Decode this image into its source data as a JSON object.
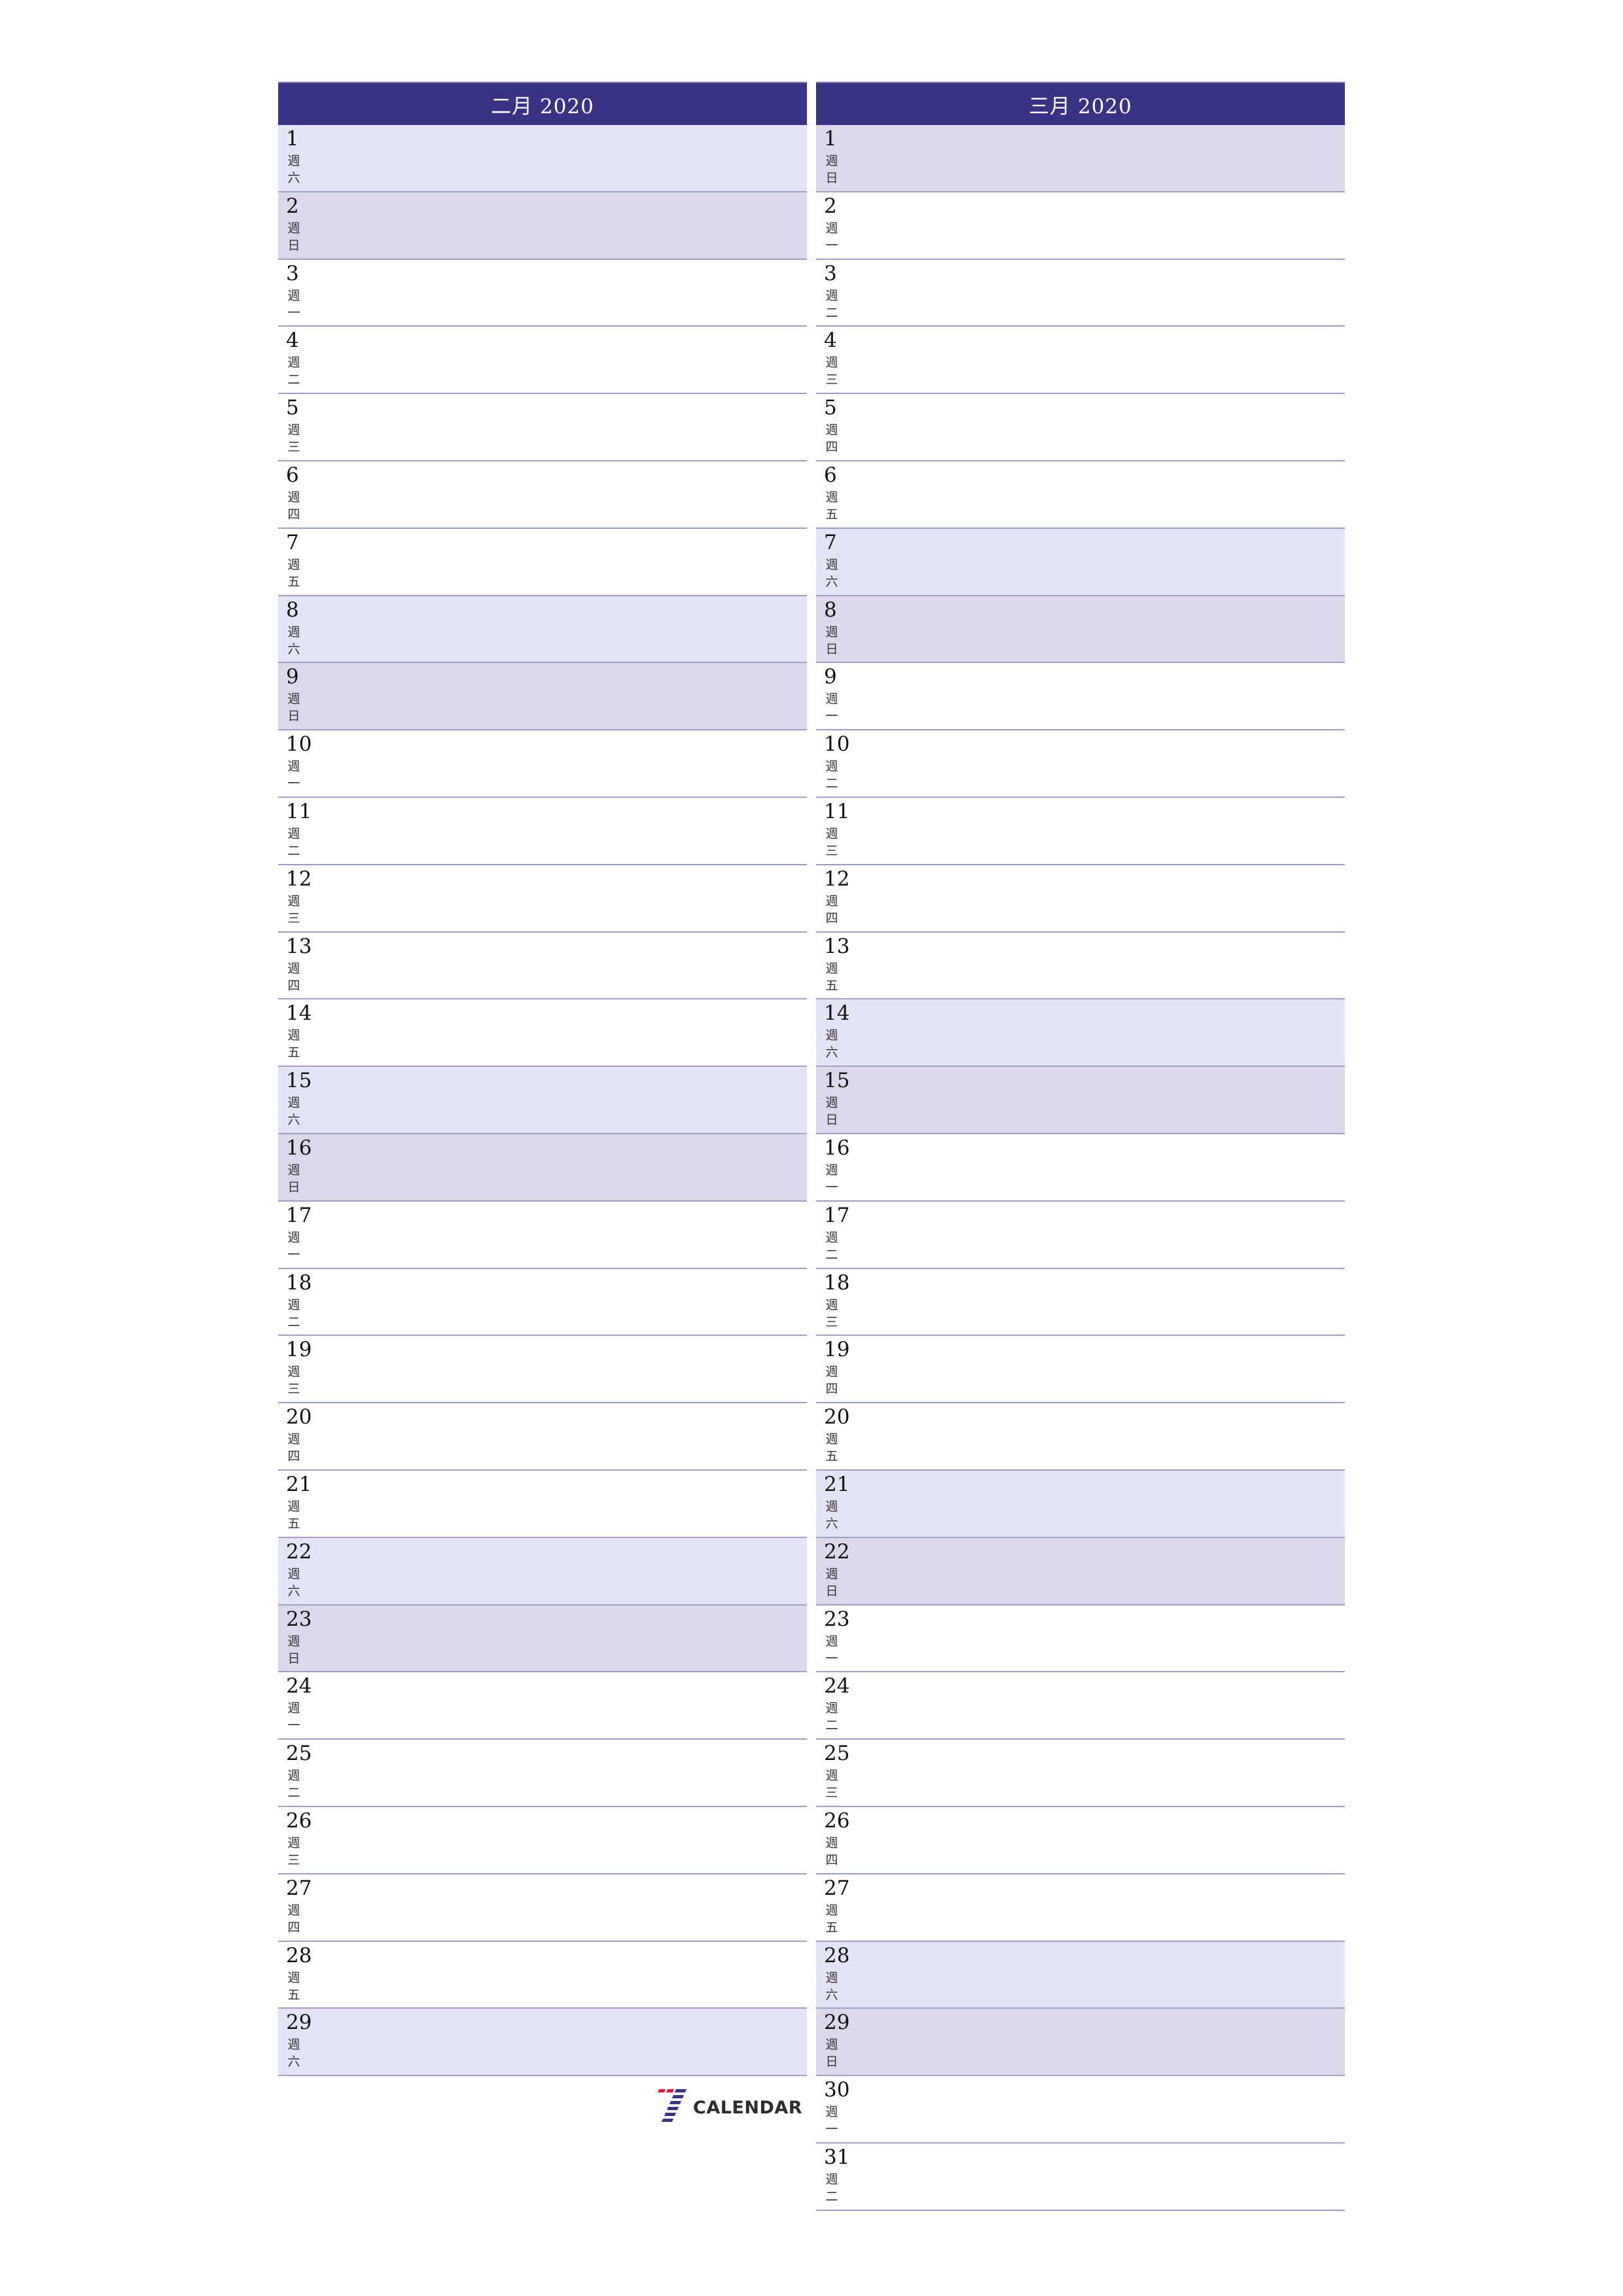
{
  "colors": {
    "header_bg": "#3a3384",
    "saturday_bg": "#e4e4f7",
    "sunday_bg": "#dcd8ec",
    "row_border": "#a19ec4",
    "logo_red": "#e8173b",
    "logo_blue": "#3a3384"
  },
  "weekday_prefix": "週",
  "months": [
    {
      "title": "二月 2020",
      "days": [
        {
          "num": "1",
          "wd": "六",
          "type": "sat"
        },
        {
          "num": "2",
          "wd": "日",
          "type": "sun"
        },
        {
          "num": "3",
          "wd": "一",
          "type": ""
        },
        {
          "num": "4",
          "wd": "二",
          "type": ""
        },
        {
          "num": "5",
          "wd": "三",
          "type": ""
        },
        {
          "num": "6",
          "wd": "四",
          "type": ""
        },
        {
          "num": "7",
          "wd": "五",
          "type": ""
        },
        {
          "num": "8",
          "wd": "六",
          "type": "sat"
        },
        {
          "num": "9",
          "wd": "日",
          "type": "sun"
        },
        {
          "num": "10",
          "wd": "一",
          "type": ""
        },
        {
          "num": "11",
          "wd": "二",
          "type": ""
        },
        {
          "num": "12",
          "wd": "三",
          "type": ""
        },
        {
          "num": "13",
          "wd": "四",
          "type": ""
        },
        {
          "num": "14",
          "wd": "五",
          "type": ""
        },
        {
          "num": "15",
          "wd": "六",
          "type": "sat"
        },
        {
          "num": "16",
          "wd": "日",
          "type": "sun"
        },
        {
          "num": "17",
          "wd": "一",
          "type": ""
        },
        {
          "num": "18",
          "wd": "二",
          "type": ""
        },
        {
          "num": "19",
          "wd": "三",
          "type": ""
        },
        {
          "num": "20",
          "wd": "四",
          "type": ""
        },
        {
          "num": "21",
          "wd": "五",
          "type": ""
        },
        {
          "num": "22",
          "wd": "六",
          "type": "sat"
        },
        {
          "num": "23",
          "wd": "日",
          "type": "sun"
        },
        {
          "num": "24",
          "wd": "一",
          "type": ""
        },
        {
          "num": "25",
          "wd": "二",
          "type": ""
        },
        {
          "num": "26",
          "wd": "三",
          "type": ""
        },
        {
          "num": "27",
          "wd": "四",
          "type": ""
        },
        {
          "num": "28",
          "wd": "五",
          "type": ""
        },
        {
          "num": "29",
          "wd": "六",
          "type": "sat"
        }
      ]
    },
    {
      "title": "三月 2020",
      "days": [
        {
          "num": "1",
          "wd": "日",
          "type": "sun"
        },
        {
          "num": "2",
          "wd": "一",
          "type": ""
        },
        {
          "num": "3",
          "wd": "二",
          "type": ""
        },
        {
          "num": "4",
          "wd": "三",
          "type": ""
        },
        {
          "num": "5",
          "wd": "四",
          "type": ""
        },
        {
          "num": "6",
          "wd": "五",
          "type": ""
        },
        {
          "num": "7",
          "wd": "六",
          "type": "sat"
        },
        {
          "num": "8",
          "wd": "日",
          "type": "sun"
        },
        {
          "num": "9",
          "wd": "一",
          "type": ""
        },
        {
          "num": "10",
          "wd": "二",
          "type": ""
        },
        {
          "num": "11",
          "wd": "三",
          "type": ""
        },
        {
          "num": "12",
          "wd": "四",
          "type": ""
        },
        {
          "num": "13",
          "wd": "五",
          "type": ""
        },
        {
          "num": "14",
          "wd": "六",
          "type": "sat"
        },
        {
          "num": "15",
          "wd": "日",
          "type": "sun"
        },
        {
          "num": "16",
          "wd": "一",
          "type": ""
        },
        {
          "num": "17",
          "wd": "二",
          "type": ""
        },
        {
          "num": "18",
          "wd": "三",
          "type": ""
        },
        {
          "num": "19",
          "wd": "四",
          "type": ""
        },
        {
          "num": "20",
          "wd": "五",
          "type": ""
        },
        {
          "num": "21",
          "wd": "六",
          "type": "sat"
        },
        {
          "num": "22",
          "wd": "日",
          "type": "sun"
        },
        {
          "num": "23",
          "wd": "一",
          "type": ""
        },
        {
          "num": "24",
          "wd": "二",
          "type": ""
        },
        {
          "num": "25",
          "wd": "三",
          "type": ""
        },
        {
          "num": "26",
          "wd": "四",
          "type": ""
        },
        {
          "num": "27",
          "wd": "五",
          "type": ""
        },
        {
          "num": "28",
          "wd": "六",
          "type": "sat"
        },
        {
          "num": "29",
          "wd": "日",
          "type": "sun"
        },
        {
          "num": "30",
          "wd": "一",
          "type": ""
        },
        {
          "num": "31",
          "wd": "二",
          "type": ""
        }
      ]
    }
  ],
  "logo": {
    "icon": "seven-stripes-icon",
    "text": "CALENDAR"
  }
}
